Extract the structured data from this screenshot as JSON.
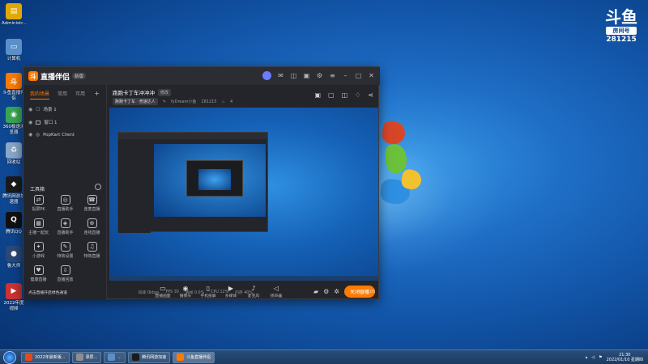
{
  "desktop": {
    "icons": [
      {
        "label": "Administr...",
        "color": "#e0a800",
        "glyph": "▤"
      },
      {
        "label": "计算机",
        "color": "#5a8fc9",
        "glyph": "▭"
      },
      {
        "label": "斗鱼直播伴侣",
        "color": "#ff7a00",
        "glyph": "斗"
      },
      {
        "label": "360极速浏览器",
        "color": "#3aa655",
        "glyph": "◉"
      },
      {
        "label": "回收站",
        "color": "#8aa7c8",
        "glyph": "♻"
      },
      {
        "label": "腾讯网游加速器",
        "color": "#1b1b1b",
        "glyph": "◆"
      },
      {
        "label": "腾讯QQ",
        "color": "#111111",
        "glyph": "Q"
      },
      {
        "label": "鲁大师",
        "color": "#2b4a78",
        "glyph": "●"
      },
      {
        "label": "2022年度视频",
        "color": "#cc3333",
        "glyph": "▶"
      }
    ],
    "badge": {
      "logo": "斗鱼",
      "tag": "房间号",
      "room": "281215"
    }
  },
  "app": {
    "name": "直播伴侣",
    "version": "新版",
    "sidebar": {
      "tabs": [
        "我的场景",
        "常用",
        "可用"
      ],
      "scenes": [
        "场景 1",
        "窗口 1",
        "PopKart Client"
      ],
      "tools_title": "工具箱",
      "tools": [
        {
          "label": "投屏PK",
          "glyph": "⇄"
        },
        {
          "label": "直播助手",
          "glyph": "◎"
        },
        {
          "label": "连麦直播",
          "glyph": "☎"
        },
        {
          "label": "主播一起玩",
          "glyph": "▦"
        },
        {
          "label": "直播助手",
          "glyph": "◈"
        },
        {
          "label": "连线直播",
          "glyph": "⊕"
        },
        {
          "label": "小游戏",
          "glyph": "✦"
        },
        {
          "label": "特效设置",
          "glyph": "✎"
        },
        {
          "label": "特效直播",
          "glyph": "♫"
        },
        {
          "label": "健康直播",
          "glyph": "♥"
        },
        {
          "label": "直播回放",
          "glyph": "⇩"
        }
      ]
    },
    "main": {
      "room_title": "跑跑卡丁车冲冲冲",
      "edit_label": "修改",
      "category": "跑跑卡丁车 · 竞速达人",
      "streamer": "fyDream小鱼",
      "room_id": "281215",
      "hot": "4",
      "controls": [
        {
          "label": "直播画面",
          "glyph": "▭"
        },
        {
          "label": "摄像头",
          "glyph": "◉"
        },
        {
          "label": "手机投屏",
          "glyph": "▯"
        },
        {
          "label": "多媒体",
          "glyph": "▶"
        },
        {
          "label": "麦克风",
          "glyph": "♪"
        },
        {
          "label": "扬声器",
          "glyph": "◁"
        }
      ],
      "stop_label": "关闭直播"
    },
    "status": {
      "warning": "点击直播开启绿色通道",
      "stats": [
        "码率 0kbps",
        "FPS 30",
        "丢帧 0.0%",
        "CPU 12%",
        "内存 40%"
      ],
      "timer": "00:00:00"
    }
  },
  "taskbar": {
    "tasks": [
      {
        "label": "2022年最新版...",
        "color": "#e64a19"
      },
      {
        "label": "录屏...",
        "color": "#8e8e8e"
      },
      {
        "label": "...",
        "color": "#5a8fc9"
      },
      {
        "label": "腾讯网游加速",
        "color": "#1b1b1b"
      },
      {
        "label": "斗鱼直播伴侣",
        "color": "#ff7a00"
      }
    ],
    "time": "21:30",
    "date": "2022/01/10 星期四"
  }
}
